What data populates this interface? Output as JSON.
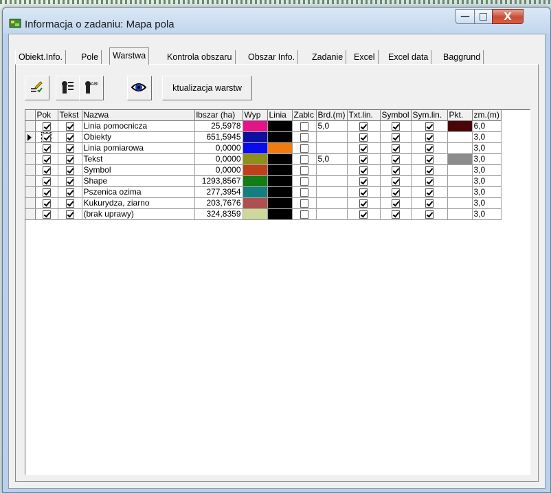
{
  "window": {
    "title": "Informacja o zadaniu: Mapa pola",
    "min_label": "—",
    "max_label": "□",
    "close_label": "X"
  },
  "tabs": [
    {
      "label": "Obiekt.Info.",
      "active": false
    },
    {
      "label": "Pole",
      "active": false
    },
    {
      "label": "Warstwa",
      "active": true
    },
    {
      "label": "Kontrola obszaru",
      "active": false
    },
    {
      "label": "Obszar Info.",
      "active": false
    },
    {
      "label": "Zadanie",
      "active": false
    },
    {
      "label": "Excel",
      "active": false
    },
    {
      "label": "Excel data",
      "active": false
    },
    {
      "label": "Baggrund",
      "active": false
    }
  ],
  "toolbar": {
    "icons": [
      "edit-layer-icon",
      "layer-list-icon",
      "layer-text-icon",
      "eye-icon"
    ],
    "refresh_label": "ktualizacja warstw"
  },
  "grid": {
    "columns": [
      "Pok",
      "Tekst",
      "Nazwa",
      "lbszar (ha)",
      "Wyp",
      "Linia",
      "Zablc",
      "Brd.(m)",
      "Txt.lin.",
      "Symbol",
      "Sym.lin.",
      "Pkt.",
      "zm.(m)"
    ],
    "rows": [
      {
        "pok": true,
        "tekst": true,
        "nazwa": "Linia pomocnicza",
        "obszar": "25,5978",
        "wyp": "#e4138a",
        "linia": "#000000",
        "zablok": false,
        "brd": "5,0",
        "txtlin": true,
        "symbol": true,
        "symlin": true,
        "pkt": "#4a0606",
        "zm": "6,0"
      },
      {
        "pok": true,
        "tekst": true,
        "nazwa": "Obiekty",
        "obszar": "651,5945",
        "wyp": "#0d0fa1",
        "linia": "#000000",
        "zablok": false,
        "brd": "",
        "txtlin": true,
        "symbol": true,
        "symlin": true,
        "pkt": "#ffffff",
        "zm": "3,0",
        "current": true
      },
      {
        "pok": true,
        "tekst": true,
        "nazwa": "Linia pomiarowa",
        "obszar": "0,0000",
        "wyp": "#0b0bf0",
        "linia": "#f07c10",
        "zablok": false,
        "brd": "",
        "txtlin": true,
        "symbol": true,
        "symlin": true,
        "pkt": "#ffffff",
        "zm": "3,0"
      },
      {
        "pok": true,
        "tekst": true,
        "nazwa": "Tekst",
        "obszar": "0,0000",
        "wyp": "#8f8f1b",
        "linia": "#000000",
        "zablok": false,
        "brd": "5,0",
        "txtlin": true,
        "symbol": true,
        "symlin": true,
        "pkt": "#8c8c8c",
        "zm": "3,0"
      },
      {
        "pok": true,
        "tekst": true,
        "nazwa": "Symbol",
        "obszar": "0,0000",
        "wyp": "#c0401c",
        "linia": "#000000",
        "zablok": false,
        "brd": "",
        "txtlin": true,
        "symbol": true,
        "symlin": true,
        "pkt": "#ffffff",
        "zm": "3,0"
      },
      {
        "pok": true,
        "tekst": true,
        "nazwa": "Shape",
        "obszar": "1293,8567",
        "wyp": "#137c13",
        "linia": "#000000",
        "zablok": false,
        "brd": "",
        "txtlin": true,
        "symbol": true,
        "symlin": true,
        "pkt": "#ffffff",
        "zm": "3,0"
      },
      {
        "pok": true,
        "tekst": true,
        "nazwa": "Pszenica ozima",
        "obszar": "277,3954",
        "wyp": "#138080",
        "linia": "#000000",
        "zablok": false,
        "brd": "",
        "txtlin": true,
        "symbol": true,
        "symlin": true,
        "pkt": "#ffffff",
        "zm": "3,0"
      },
      {
        "pok": true,
        "tekst": true,
        "nazwa": "Kukurydza, ziarno",
        "obszar": "203,7676",
        "wyp": "#ad5050",
        "linia": "#000000",
        "zablok": false,
        "brd": "",
        "txtlin": true,
        "symbol": true,
        "symlin": true,
        "pkt": "#ffffff",
        "zm": "3,0"
      },
      {
        "pok": true,
        "tekst": true,
        "nazwa": "(brak uprawy)",
        "obszar": "324,8359",
        "wyp": "#cdd89a",
        "linia": "#000000",
        "zablok": false,
        "brd": "",
        "txtlin": true,
        "symbol": true,
        "symlin": true,
        "pkt": "#ffffff",
        "zm": "3,0"
      }
    ]
  }
}
